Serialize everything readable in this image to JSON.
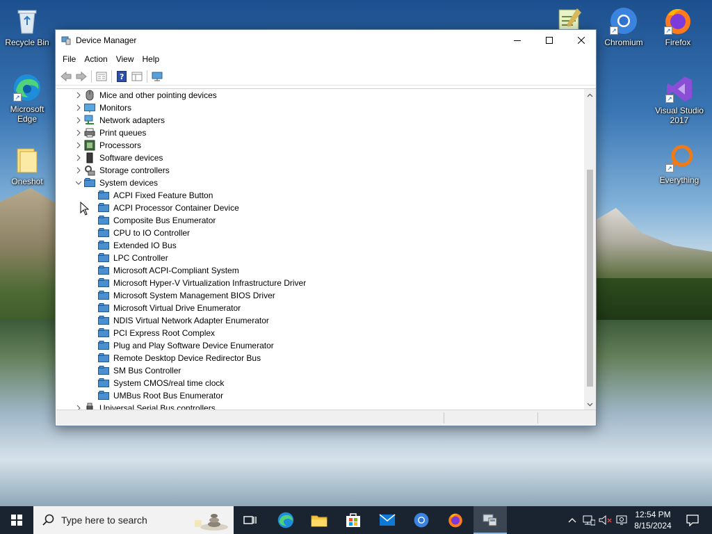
{
  "desktop": {
    "left_icons": [
      {
        "name": "recycle-bin",
        "label": "Recycle Bin"
      },
      {
        "name": "microsoft-edge",
        "label": "Microsoft\nEdge"
      },
      {
        "name": "oneshot",
        "label": "Oneshot"
      }
    ],
    "right_icons": [
      {
        "name": "chromium",
        "label": "Chromium"
      },
      {
        "name": "firefox",
        "label": "Firefox"
      },
      {
        "name": "visual-studio",
        "label": "Visual Studio\n2017"
      },
      {
        "name": "everything",
        "label": "Everything"
      }
    ]
  },
  "window": {
    "title": "Device Manager",
    "icon": "device-manager-icon",
    "controls": [
      "minimize",
      "maximize",
      "close"
    ]
  },
  "menu": [
    "File",
    "Action",
    "View",
    "Help"
  ],
  "toolbar": [
    "back-arrow-icon",
    "forward-arrow-icon",
    "properties-icon",
    "help-icon",
    "show-hide-console-tree-icon",
    "monitor-icon"
  ],
  "tree": {
    "categories_above": [
      {
        "label": "Mice and other pointing devices",
        "icon": "mouse-icon"
      },
      {
        "label": "Monitors",
        "icon": "monitor-icon"
      },
      {
        "label": "Network adapters",
        "icon": "network-adapter-icon"
      },
      {
        "label": "Print queues",
        "icon": "printer-icon"
      },
      {
        "label": "Processors",
        "icon": "processor-icon"
      },
      {
        "label": "Software devices",
        "icon": "software-device-icon"
      },
      {
        "label": "Storage controllers",
        "icon": "storage-controller-icon"
      }
    ],
    "expanded": {
      "label": "System devices",
      "icon": "system-devices-icon",
      "children": [
        "ACPI Fixed Feature Button",
        "ACPI Processor Container Device",
        "Composite Bus Enumerator",
        "CPU to IO Controller",
        "Extended IO Bus",
        "LPC Controller",
        "Microsoft ACPI-Compliant System",
        "Microsoft Hyper-V Virtualization Infrastructure Driver",
        "Microsoft System Management BIOS Driver",
        "Microsoft Virtual Drive Enumerator",
        "NDIS Virtual Network Adapter Enumerator",
        "PCI Express Root Complex",
        "Plug and Play Software Device Enumerator",
        "Remote Desktop Device Redirector Bus",
        "SM Bus Controller",
        "System CMOS/real time clock",
        "UMBus Root Bus Enumerator"
      ]
    },
    "categories_below": [
      {
        "label": "Universal Serial Bus controllers",
        "icon": "usb-icon"
      }
    ]
  },
  "taskbar": {
    "search_placeholder": "Type here to search",
    "apps": [
      "task-view-icon",
      "edge-icon",
      "file-explorer-icon",
      "microsoft-store-icon",
      "mail-icon",
      "chromium-icon",
      "firefox-icon",
      "device-manager-icon"
    ],
    "active_app": "device-manager-icon",
    "clock": {
      "time": "12:54 PM",
      "date": "8/15/2024"
    }
  }
}
